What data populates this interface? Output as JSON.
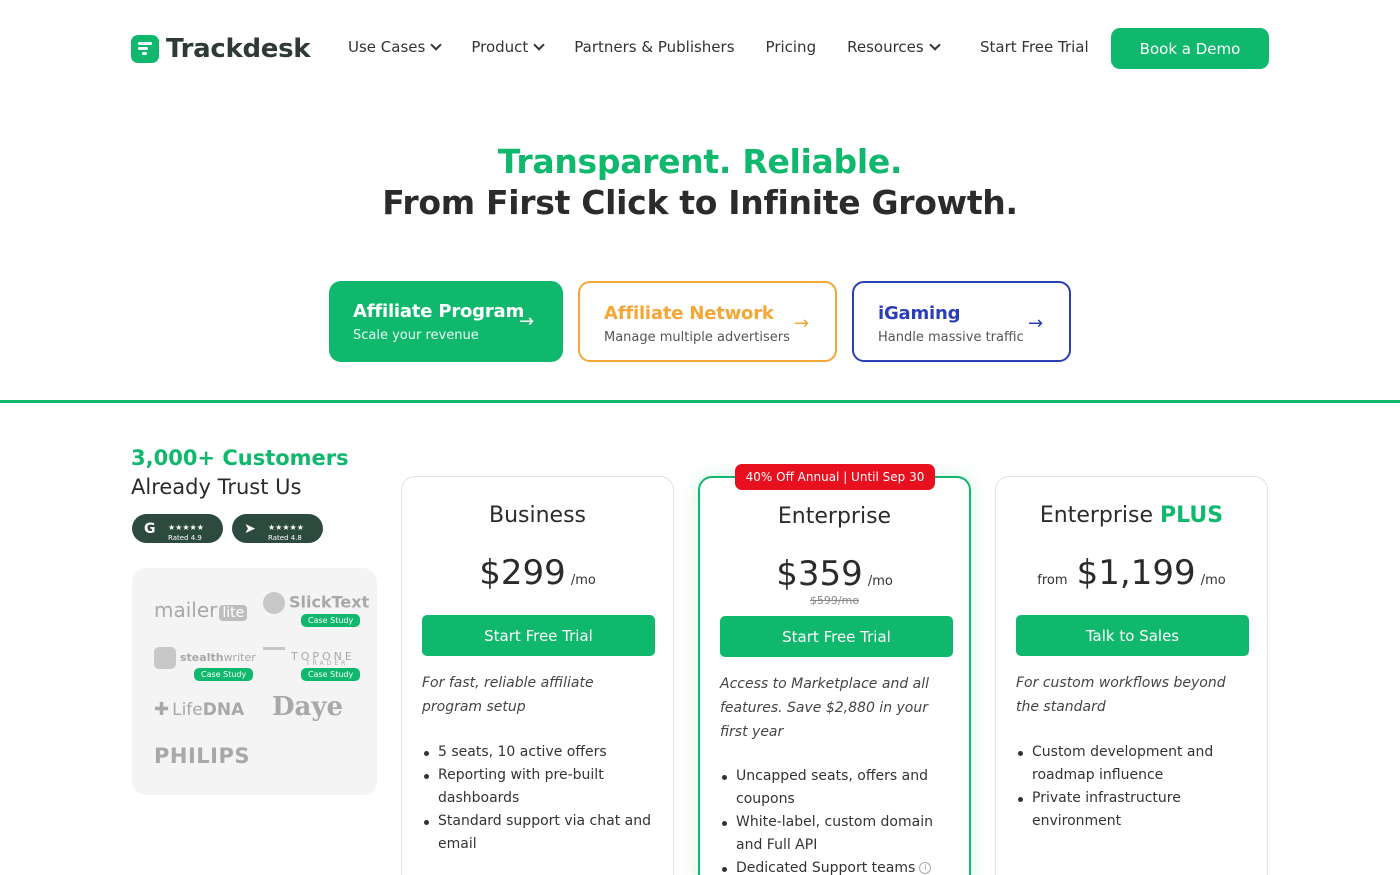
{
  "nav": {
    "brand": "Trackdesk",
    "items": [
      {
        "label": "Use Cases",
        "dropdown": true
      },
      {
        "label": "Product",
        "dropdown": true
      },
      {
        "label": "Partners & Publishers",
        "dropdown": false
      },
      {
        "label": "Pricing",
        "dropdown": false
      },
      {
        "label": "Resources",
        "dropdown": true
      }
    ],
    "start_trial": "Start Free Trial",
    "book_demo": "Book a Demo"
  },
  "hero": {
    "headline_accent": "Transparent. Reliable.",
    "headline": "From First Click to Infinite Growth."
  },
  "segments": [
    {
      "title": "Affiliate Program",
      "subtitle": "Scale your revenue",
      "arrow": "→"
    },
    {
      "title": "Affiliate Network",
      "subtitle": "Manage multiple advertisers",
      "arrow": "→"
    },
    {
      "title": "iGaming",
      "subtitle": "Handle massive traffic",
      "arrow": "→"
    }
  ],
  "customers": {
    "count_line": "3,000+ Customers",
    "trust_line": "Already Trust Us",
    "badges": [
      {
        "icon": "G",
        "stars": "★★★★★",
        "rating": "Rated 4.9"
      },
      {
        "icon": "➤",
        "stars": "★★★★★",
        "rating": "Rated 4.8"
      }
    ],
    "logos": {
      "mailerlite_a": "mailer",
      "mailerlite_b": "lite",
      "slicktext": "SlickText",
      "stealthwriter_a": "stealth",
      "stealthwriter_b": "writer",
      "topone": "TOPONE",
      "topone_sub": "TRADER",
      "lifedna_a": "Life",
      "lifedna_b": "DNA",
      "daye": "Daye",
      "philips": "PHILIPS",
      "case_study": "Case Study"
    }
  },
  "plans": {
    "promo": "40% Off Annual | Until Sep 30",
    "business": {
      "name": "Business",
      "price": "$299",
      "period": "/mo",
      "cta": "Start Free Trial",
      "description": "For fast, reliable affiliate program setup",
      "features": [
        "5 seats, 10 active offers",
        "Reporting with pre-built dashboards",
        "Standard support via chat and email"
      ]
    },
    "enterprise": {
      "name": "Enterprise",
      "price": "$359",
      "period": "/mo",
      "old_price": "$599/mo",
      "cta": "Start Free Trial",
      "description": "Access to Marketplace and all features. Save $2,880 in your first year",
      "features": [
        "Uncapped seats, offers and coupons",
        "White-label, custom domain and Full API",
        "Dedicated Support teams"
      ]
    },
    "enterprise_plus": {
      "name": "Enterprise",
      "name_accent": "PLUS",
      "prefix": "from",
      "price": "$1,199",
      "period": "/mo",
      "cta": "Talk to Sales",
      "description": "For custom workflows beyond the standard",
      "features": [
        "Custom development and roadmap influence",
        "Private infrastructure environment"
      ]
    }
  },
  "colors": {
    "brand": "#0fb86c",
    "network": "#f4a636",
    "igaming": "#2b3fb5",
    "promo": "#e8101e"
  }
}
